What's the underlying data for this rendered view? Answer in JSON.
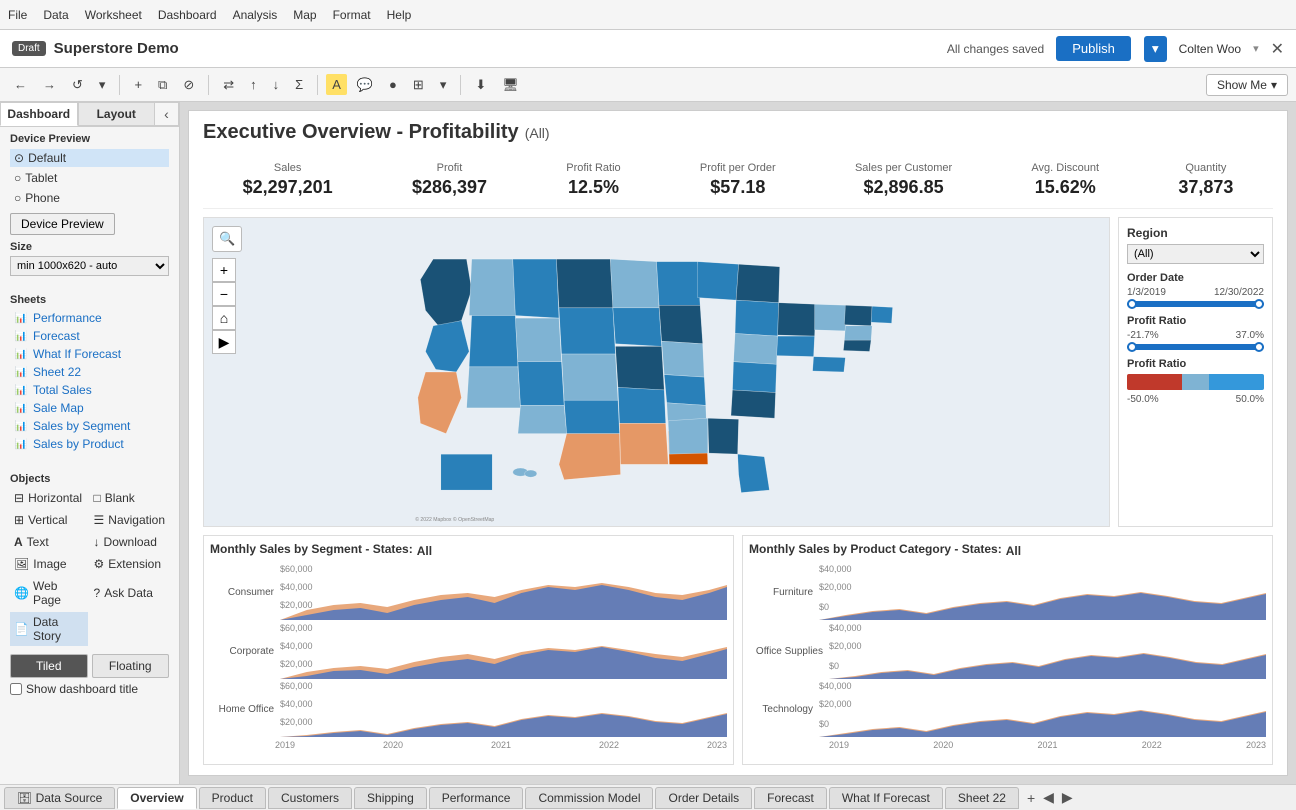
{
  "menubar": {
    "items": [
      "File",
      "Data",
      "Worksheet",
      "Dashboard",
      "Analysis",
      "Map",
      "Format",
      "Help"
    ]
  },
  "titlebar": {
    "draft_label": "Draft",
    "title": "Superstore Demo",
    "saved_text": "All changes saved",
    "publish_label": "Publish",
    "user_name": "Colten Woo"
  },
  "sidebar": {
    "tabs": [
      {
        "label": "Dashboard",
        "active": true
      },
      {
        "label": "Layout",
        "active": false
      }
    ],
    "device_label": "Device Preview",
    "devices": [
      {
        "label": "Default",
        "selected": true
      },
      {
        "label": "Tablet",
        "selected": false
      },
      {
        "label": "Phone",
        "selected": false
      }
    ],
    "size_label": "Size",
    "size_value": "min 1000x620 - auto",
    "sheets_label": "Sheets",
    "sheets": [
      {
        "label": "Performance"
      },
      {
        "label": "Forecast"
      },
      {
        "label": "What If Forecast"
      },
      {
        "label": "Sheet 22"
      },
      {
        "label": "Total Sales"
      },
      {
        "label": "Sale Map"
      },
      {
        "label": "Sales by Segment"
      },
      {
        "label": "Sales by Product"
      }
    ],
    "objects_label": "Objects",
    "objects": [
      {
        "label": "Horizontal",
        "icon": "⊟"
      },
      {
        "label": "Blank",
        "icon": "□"
      },
      {
        "label": "Vertical",
        "icon": "⊞"
      },
      {
        "label": "Navigation",
        "icon": "☰"
      },
      {
        "label": "Text",
        "icon": "A"
      },
      {
        "label": "Download",
        "icon": "↓"
      },
      {
        "label": "Image",
        "icon": "🖼"
      },
      {
        "label": "Extension",
        "icon": "⚙"
      },
      {
        "label": "Web Page",
        "icon": "🌐"
      },
      {
        "label": "Ask Data",
        "icon": "?"
      },
      {
        "label": "Data Story",
        "icon": "📄"
      }
    ],
    "tiled_label": "Tiled",
    "floating_label": "Floating",
    "show_title_label": "Show dashboard title"
  },
  "dashboard": {
    "title": "Executive Overview - Profitability",
    "title_filter": "(All)",
    "kpis": [
      {
        "label": "Sales",
        "value": "$2,297,201"
      },
      {
        "label": "Profit",
        "value": "$286,397"
      },
      {
        "label": "Profit Ratio",
        "value": "12.5%"
      },
      {
        "label": "Profit per Order",
        "value": "$57.18"
      },
      {
        "label": "Sales per Customer",
        "value": "$2,896.85"
      },
      {
        "label": "Avg. Discount",
        "value": "15.62%"
      },
      {
        "label": "Quantity",
        "value": "37,873"
      }
    ],
    "filters": {
      "region_label": "Region",
      "region_value": "(All)",
      "order_date_label": "Order Date",
      "date_start": "1/3/2019",
      "date_end": "12/30/2022",
      "profit_ratio_label": "Profit Ratio",
      "profit_ratio_min": "-21.7%",
      "profit_ratio_max": "37.0%",
      "profit_ratio_bar_label": "Profit Ratio",
      "pr_min": "-50.0%",
      "pr_max": "50.0%"
    },
    "segment_chart": {
      "title": "Monthly Sales by Segment - States:",
      "states_filter": "All",
      "rows": [
        {
          "label": "Consumer",
          "y_labels": [
            "$60,000",
            "$40,000",
            "$20,000"
          ]
        },
        {
          "label": "Corporate",
          "y_labels": [
            "$60,000",
            "$40,000",
            "$20,000"
          ]
        },
        {
          "label": "Home Office",
          "y_labels": [
            "$60,000",
            "$40,000",
            "$20,000"
          ]
        }
      ],
      "x_labels": [
        "2019",
        "2020",
        "2021",
        "2022",
        "2023"
      ]
    },
    "category_chart": {
      "title": "Monthly Sales by Product Category - States:",
      "states_filter": "All",
      "rows": [
        {
          "label": "Furniture",
          "y_labels": [
            "$40,000",
            "$20,000",
            "$0"
          ]
        },
        {
          "label": "Office Supplies",
          "y_labels": [
            "$40,000",
            "$20,000",
            "$0"
          ]
        },
        {
          "label": "Technology",
          "y_labels": [
            "$40,000",
            "$20,000",
            "$0"
          ]
        }
      ],
      "x_labels": [
        "2019",
        "2020",
        "2021",
        "2022",
        "2023"
      ]
    }
  },
  "bottom_tabs": {
    "tabs": [
      {
        "label": "Data Source",
        "active": false,
        "icon": "db"
      },
      {
        "label": "Overview",
        "active": true
      },
      {
        "label": "Product",
        "active": false
      },
      {
        "label": "Customers",
        "active": false
      },
      {
        "label": "Shipping",
        "active": false
      },
      {
        "label": "Performance",
        "active": false
      },
      {
        "label": "Commission Model",
        "active": false
      },
      {
        "label": "Order Details",
        "active": false
      },
      {
        "label": "Forecast",
        "active": false
      },
      {
        "label": "What If Forecast",
        "active": false
      },
      {
        "label": "Sheet 22",
        "active": false
      }
    ]
  },
  "show_me": "Show Me"
}
